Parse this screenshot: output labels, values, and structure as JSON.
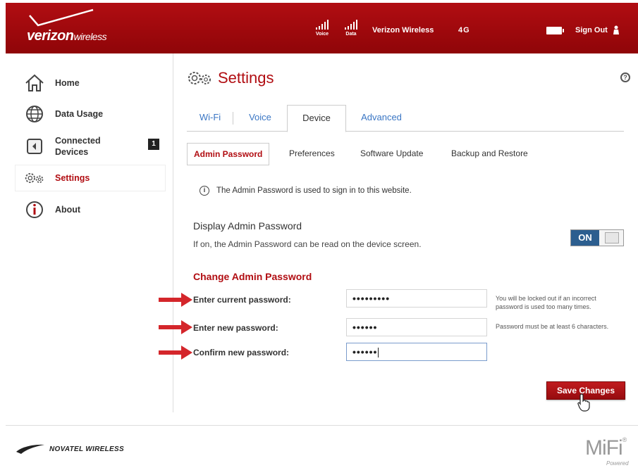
{
  "header": {
    "brand_main": "verizon",
    "brand_sub": "wireless",
    "signal_voice_label": "Voice",
    "signal_data_label": "Data",
    "carrier": "Verizon Wireless",
    "network": "4G",
    "sign_out": "Sign Out"
  },
  "sidebar": {
    "items": [
      {
        "label": "Home",
        "icon": "home-icon"
      },
      {
        "label": "Data Usage",
        "icon": "globe-icon"
      },
      {
        "label": "Connected Devices",
        "icon": "device-icon",
        "badge": "1"
      },
      {
        "label": "Settings",
        "icon": "gear-icon"
      },
      {
        "label": "About",
        "icon": "info-icon"
      }
    ]
  },
  "main": {
    "title": "Settings",
    "help": "?",
    "tabs": [
      "Wi-Fi",
      "Voice",
      "Device",
      "Advanced"
    ],
    "active_tab": "Device",
    "subtabs": [
      "Admin Password",
      "Preferences",
      "Software Update",
      "Backup and Restore"
    ],
    "active_subtab": "Admin Password",
    "info_text": "The Admin Password is used to sign in to this website.",
    "display_admin": {
      "title": "Display Admin Password",
      "desc": "If on, the Admin Password can be read on the device screen.",
      "toggle": "ON"
    },
    "change_title": "Change Admin Password",
    "fields": [
      {
        "label": "Enter current password:",
        "value": "•••••••••",
        "hint": "You will be locked out if an incorrect password is used too many times."
      },
      {
        "label": "Enter new password:",
        "value": "••••••",
        "hint": "Password must be at least 6 characters."
      },
      {
        "label": "Confirm new password:",
        "value": "••••••",
        "hint": ""
      }
    ],
    "save_label": "Save Changes"
  },
  "footer": {
    "novatel": "NOVATEL WIRELESS",
    "mifi": "MiFi",
    "reg": "®",
    "powered": "Powered"
  },
  "colors": {
    "brand_red": "#b10d12",
    "link_blue": "#3a76c4",
    "toggle_blue": "#2c5e8f",
    "arrow_red": "#d4262b"
  }
}
